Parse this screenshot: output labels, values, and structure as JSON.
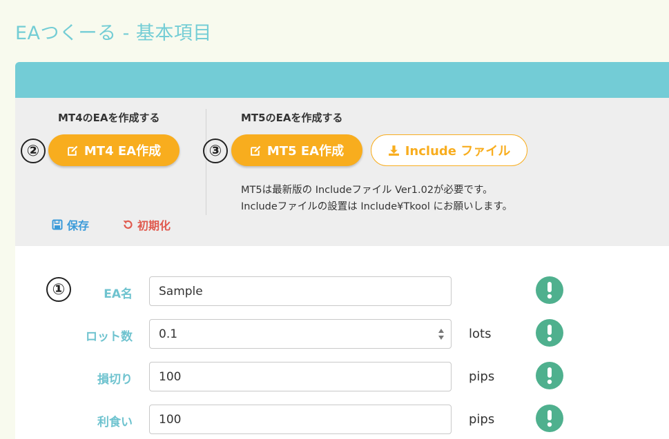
{
  "page": {
    "title": "EAつくーる - 基本項目"
  },
  "toolbar": {
    "mt4": {
      "section_title": "MT4のEAを作成する",
      "step_number": "②",
      "button_label": "MT4 EA作成",
      "button_icon": "edit-icon"
    },
    "mt5": {
      "section_title": "MT5のEAを作成する",
      "step_number": "③",
      "button_label": "MT5 EA作成",
      "button_icon": "edit-icon",
      "include_button_label": "Include ファイル",
      "include_button_icon": "download-icon"
    },
    "note_line1": "MT5は最新版の Includeファイル Ver1.02が必要です。",
    "note_line2": "Includeファイルの設置は Include¥Tkool にお願いします。",
    "save_label": "保存",
    "save_icon": "floppy-disk-icon",
    "reset_label": "初期化",
    "reset_icon": "undo-icon"
  },
  "form": {
    "step_number": "①",
    "rows": [
      {
        "label": "EA名",
        "value": "Sample",
        "unit": ""
      },
      {
        "label": "ロット数",
        "value": "0.1",
        "unit": "lots"
      },
      {
        "label": "損切り",
        "value": "100",
        "unit": "pips"
      },
      {
        "label": "利食い",
        "value": "100",
        "unit": "pips"
      }
    ]
  },
  "colors": {
    "accent": "#73ccd6",
    "orange": "#f8ad1e",
    "warning": "#4fb08e",
    "save": "#3a9ad9",
    "reset": "#e05a4e"
  }
}
